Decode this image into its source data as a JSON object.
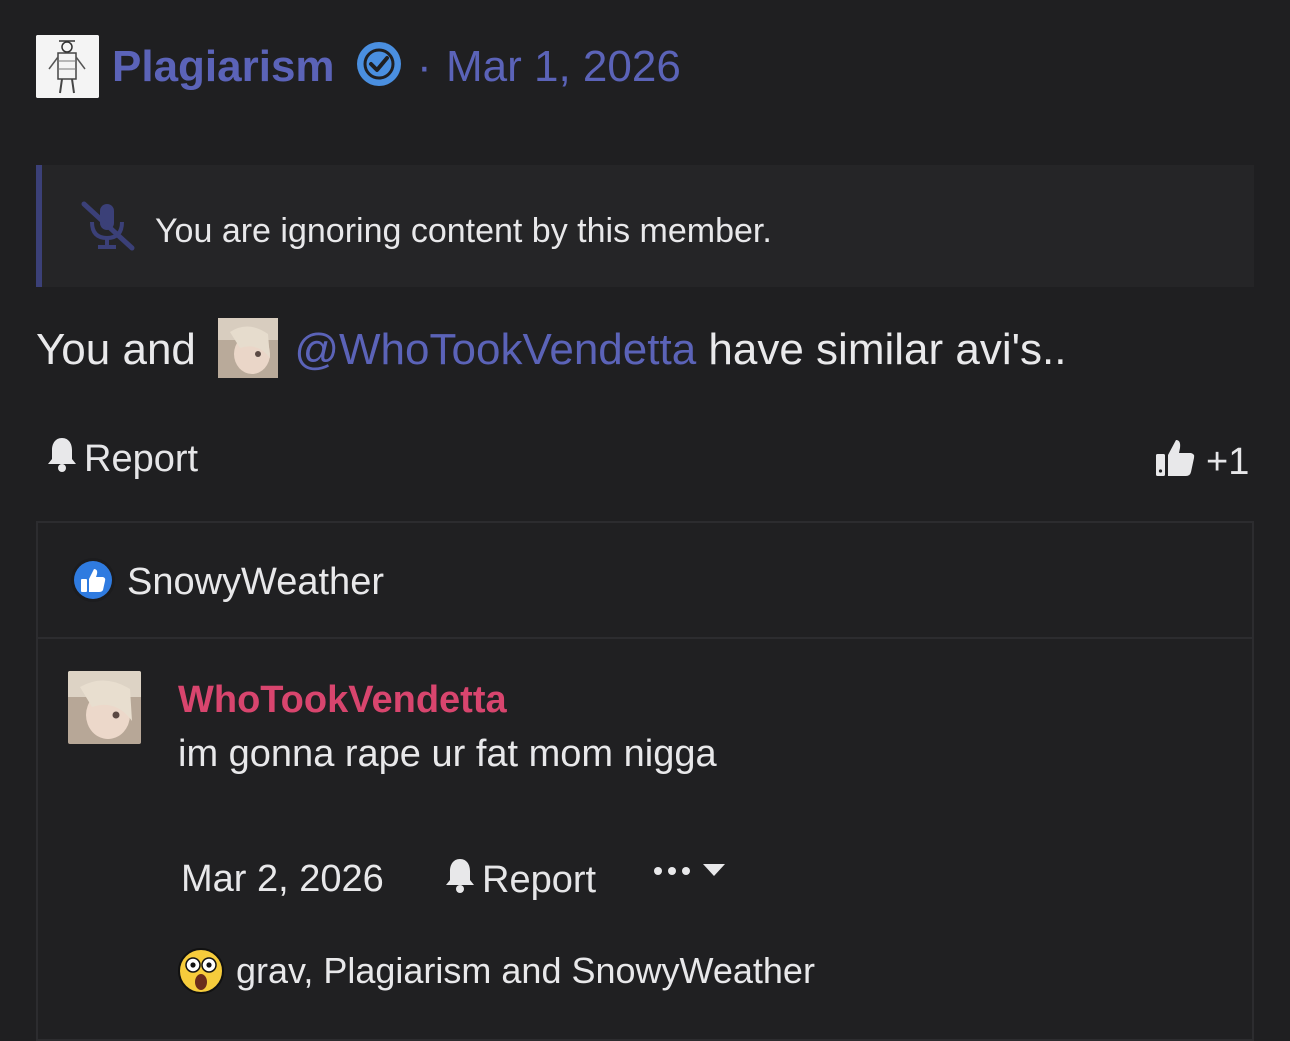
{
  "post": {
    "author": "Plagiarism",
    "separator": "·",
    "date": "Mar 1, 2026",
    "ignore_notice": "You are ignoring content by this member.",
    "message_prefix": "You and",
    "mention": "@WhoTookVendetta",
    "message_suffix": "have similar avi's..",
    "report_label": "Report",
    "like_count": "+1"
  },
  "reactions": {
    "reactor": "SnowyWeather"
  },
  "comment": {
    "author": "WhoTookVendetta",
    "text": "im gonna rape ur fat mom nigga",
    "date": "Mar 2, 2026",
    "report_label": "Report",
    "reacted_by": "grav, Plagiarism and SnowyWeather"
  },
  "colors": {
    "background": "#1f1f21",
    "link": "#5b63b8",
    "verified": "#4a8fe0",
    "comment_author": "#d8456e"
  },
  "icons": [
    "verified-badge-icon",
    "mute-icon",
    "bell-icon",
    "thumbs-up-icon",
    "like-reaction-icon",
    "ellipsis-icon",
    "caret-down-icon",
    "shocked-emoji-icon"
  ]
}
